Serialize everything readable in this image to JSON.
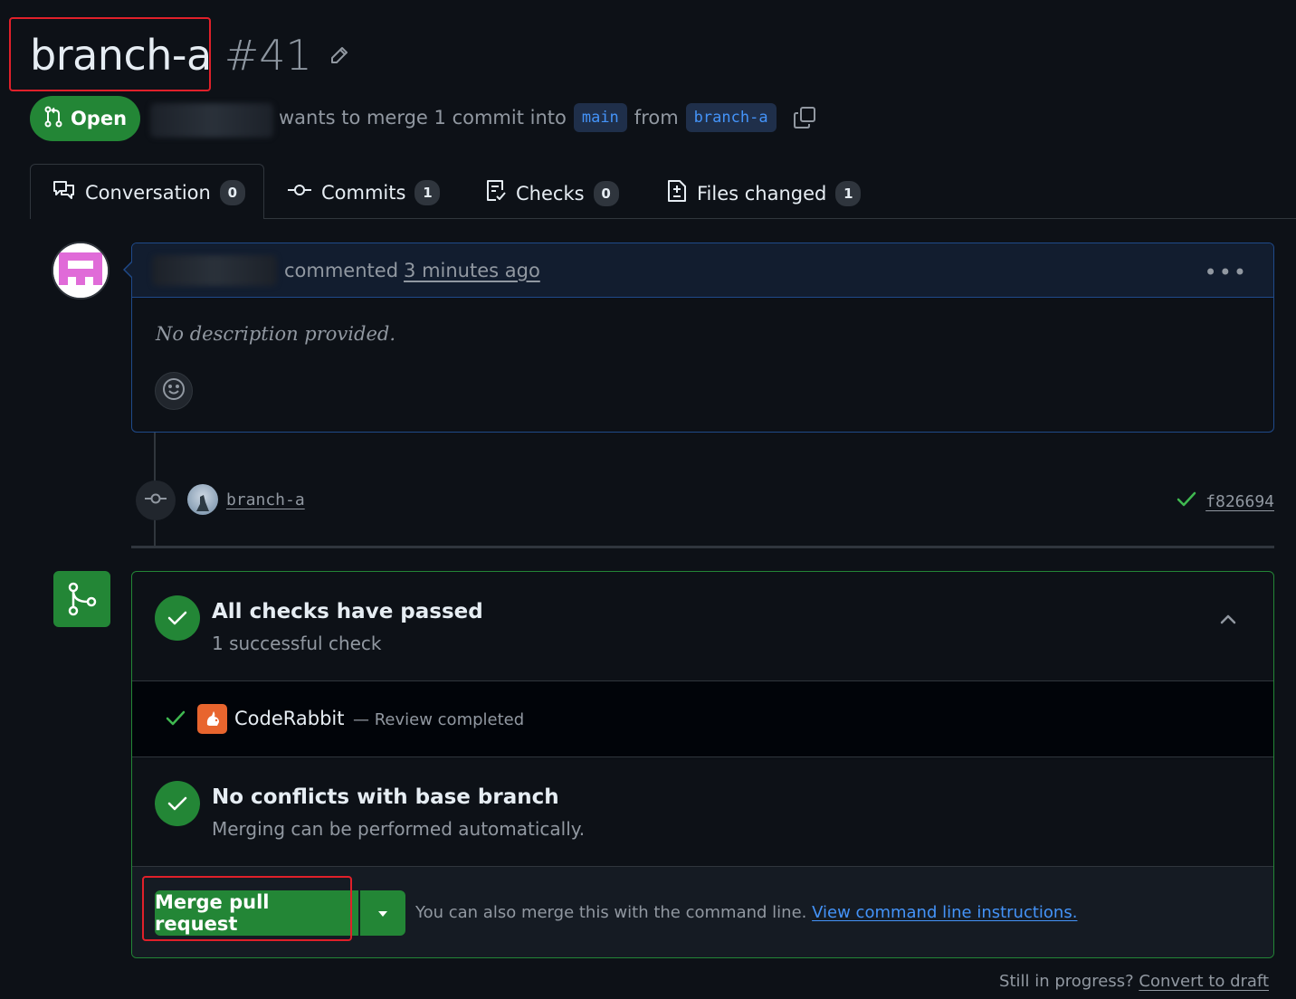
{
  "pr": {
    "title": "branch-a",
    "number": "#41",
    "state_label": "Open",
    "status_text": "wants to merge 1 commit into",
    "base_branch": "main",
    "from_label": "from",
    "head_branch": "branch-a"
  },
  "tabs": [
    {
      "label": "Conversation",
      "count": "0"
    },
    {
      "label": "Commits",
      "count": "1"
    },
    {
      "label": "Checks",
      "count": "0"
    },
    {
      "label": "Files changed",
      "count": "1"
    }
  ],
  "comment": {
    "action": "commented",
    "time": "3 minutes ago",
    "body": "No description provided."
  },
  "commit": {
    "message": "branch-a",
    "sha": "f826694"
  },
  "checks": {
    "title": "All checks have passed",
    "subtitle": "1 successful check",
    "items": [
      {
        "name": "CodeRabbit",
        "description": "— Review completed"
      }
    ]
  },
  "conflicts": {
    "title": "No conflicts with base branch",
    "subtitle": "Merging can be performed automatically."
  },
  "merge": {
    "button_label": "Merge pull request",
    "hint_text": "You can also merge this with the command line.",
    "hint_link": "View command line instructions."
  },
  "footer": {
    "question": "Still in progress?",
    "link": "Convert to draft"
  },
  "colors": {
    "background": "#0d1117",
    "success": "#238636",
    "accent": "#4493f8",
    "highlight": "#e0202a"
  }
}
